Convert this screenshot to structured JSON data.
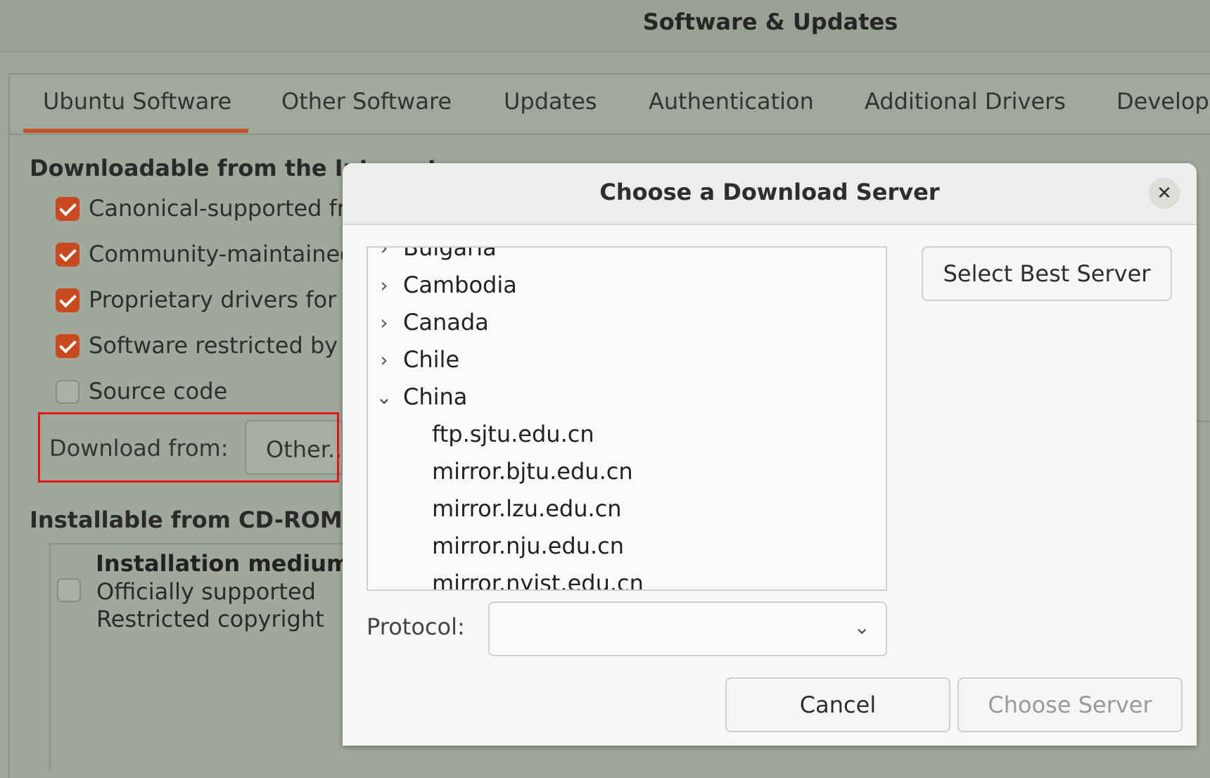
{
  "window": {
    "title": "Software & Updates"
  },
  "tabs": [
    {
      "label": "Ubuntu Software",
      "active": true
    },
    {
      "label": "Other Software"
    },
    {
      "label": "Updates"
    },
    {
      "label": "Authentication"
    },
    {
      "label": "Additional Drivers"
    },
    {
      "label": "Develope"
    }
  ],
  "internet_section": {
    "heading": "Downloadable from the Internet",
    "options": [
      {
        "label": "Canonical-supported free and open-source software (main)",
        "checked": true
      },
      {
        "label": "Community-maintained free and open-source software (universe)",
        "checked": true
      },
      {
        "label": "Proprietary drivers for devices (restricted)",
        "checked": true
      },
      {
        "label": "Software restricted by copyright or legal issues (multiverse)",
        "checked": true
      },
      {
        "label": "Source code",
        "checked": false
      }
    ],
    "download_from_label": "Download from:",
    "download_from_value": "Other..."
  },
  "cdrom_section": {
    "heading": "Installable from CD-ROM/DVD",
    "medium_title": "Installation medium",
    "medium_lines": [
      "Officially supported",
      "Restricted copyright"
    ],
    "checked": false
  },
  "dialog": {
    "title": "Choose a Download Server",
    "close_glyph": "✕",
    "tree": [
      {
        "label": "Bulgaria",
        "expanded": false,
        "level": 0
      },
      {
        "label": "Cambodia",
        "expanded": false,
        "level": 0
      },
      {
        "label": "Canada",
        "expanded": false,
        "level": 0
      },
      {
        "label": "Chile",
        "expanded": false,
        "level": 0
      },
      {
        "label": "China",
        "expanded": true,
        "level": 0
      },
      {
        "label": "ftp.sjtu.edu.cn",
        "level": 1
      },
      {
        "label": "mirror.bjtu.edu.cn",
        "level": 1
      },
      {
        "label": "mirror.lzu.edu.cn",
        "level": 1
      },
      {
        "label": "mirror.nju.edu.cn",
        "level": 1
      },
      {
        "label": "mirror.nyist.edu.cn",
        "level": 1
      }
    ],
    "select_best_label": "Select Best Server",
    "protocol_label": "Protocol:",
    "protocol_value": "",
    "cancel_label": "Cancel",
    "choose_label": "Choose Server"
  },
  "icons": {
    "collapsed": "chevron-right-icon",
    "expanded": "chevron-down-icon",
    "close": "close-icon",
    "dropdown": "chevron-down-icon"
  },
  "colors": {
    "accent": "#c8491e",
    "highlight_box": "#e61515"
  }
}
